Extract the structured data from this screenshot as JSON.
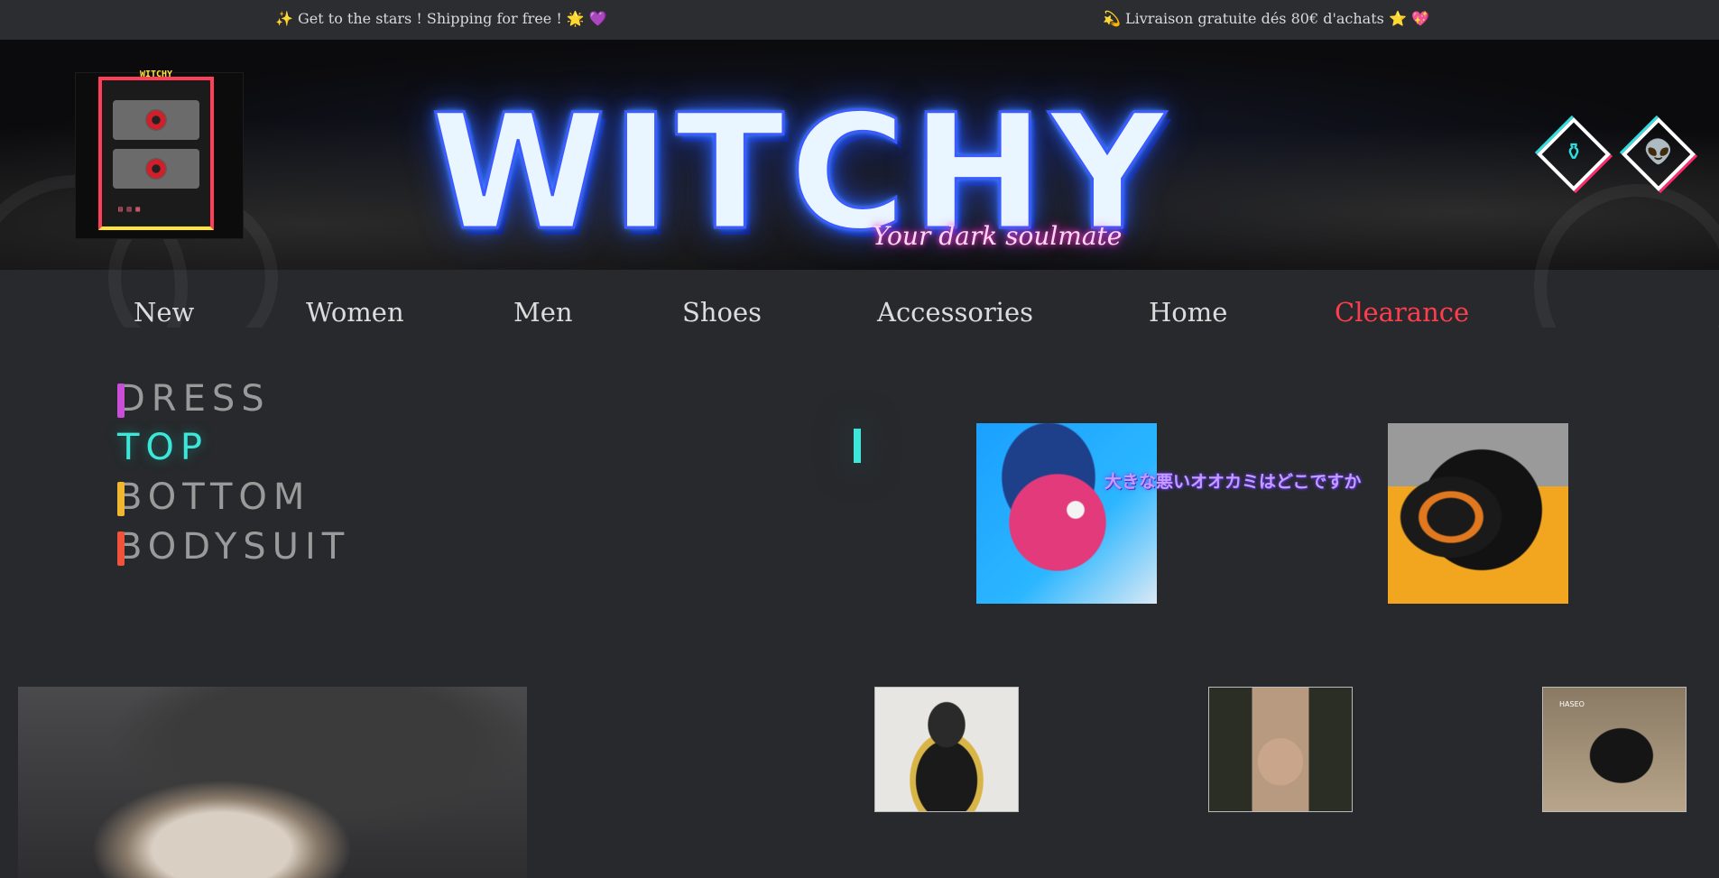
{
  "announcement": {
    "left": "✨ Get to the stars ! Shipping for free ! 🌟 💜",
    "right": "💫 Livraison gratuite dés 80€ d'achats ⭐ 💖"
  },
  "header": {
    "logo_title": "WITCHY",
    "brand": "WITCHY",
    "tagline": "Your dark soulmate",
    "social_icons": [
      "cauldron-icon",
      "alien-icon"
    ]
  },
  "nav": {
    "items": [
      "New",
      "Women",
      "Men",
      "Shoes",
      "Accessories",
      "Home",
      "Clearance"
    ],
    "accent_color": "#ff3d4d"
  },
  "mega_menu": {
    "categories": [
      {
        "label": "DRESS",
        "bar_color": "#c94fd8"
      },
      {
        "label": "TOP",
        "bar_color": "#3de6d8"
      },
      {
        "label": "BOTTOM",
        "bar_color": "#f2b731"
      },
      {
        "label": "BODYSUIT",
        "bar_color": "#f0533a"
      }
    ],
    "active_category": "TOP",
    "jp_text": "大きな悪いオオカミはどこですか",
    "thumb3_label": "HASEO"
  }
}
